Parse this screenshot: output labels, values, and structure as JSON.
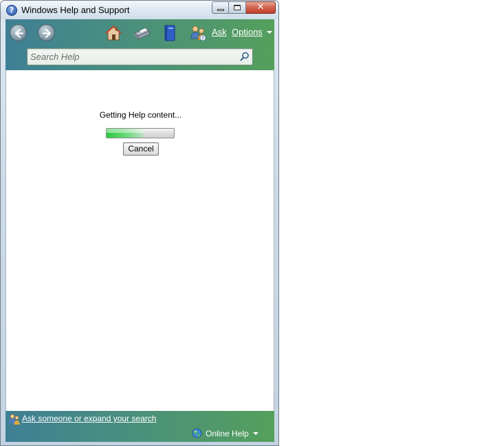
{
  "window": {
    "title": "Windows Help and Support",
    "app_icon_glyph": "?",
    "controls": {
      "minimize": "minimize-icon",
      "maximize": "maximize-icon",
      "close_glyph": "✕"
    }
  },
  "toolbar": {
    "icons": [
      "back-arrow-icon",
      "forward-arrow-icon",
      "home-icon",
      "print-icon",
      "browse-help-icon",
      "ask-icon"
    ],
    "ask_label": "Ask",
    "options_label": "Options"
  },
  "search": {
    "placeholder": "Search Help"
  },
  "content": {
    "status_text": "Getting Help content...",
    "progress_fraction": 0.55,
    "cancel_label": "Cancel"
  },
  "footer": {
    "ask_link_text": "Ask someone or expand your search",
    "online_help_label": "Online Help"
  },
  "colors": {
    "toolbar_from": "#3f7f95",
    "toolbar_to": "#559f5c",
    "progress_green": "#28c83c"
  }
}
